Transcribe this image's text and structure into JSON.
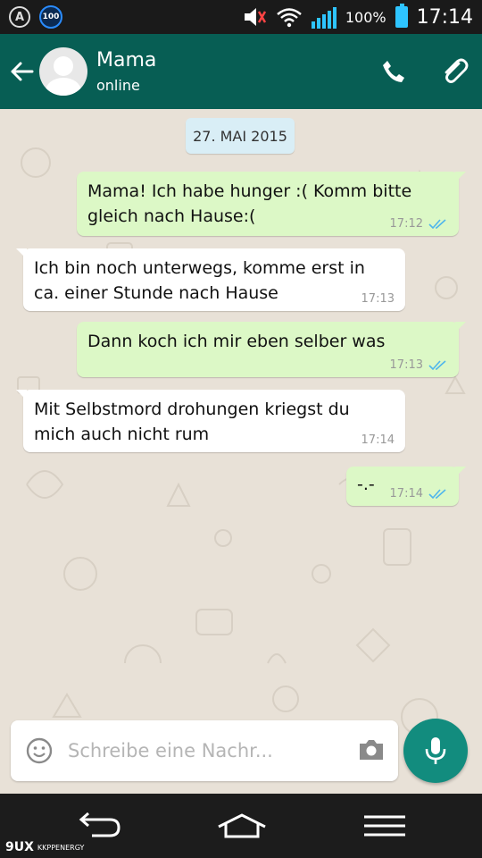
{
  "status_bar": {
    "battery_percent": "100%",
    "time": "17:14",
    "notif_badge": "100",
    "accent_color": "#2ec4ff"
  },
  "header": {
    "contact_name": "Mama",
    "contact_status": "online",
    "color": "#075e54"
  },
  "chat": {
    "date_label": "27. MAI 2015",
    "messages": [
      {
        "direction": "out",
        "text": "Mama! Ich habe hunger :( Komm bitte gleich nach Hause:(",
        "time": "17:12",
        "read": true
      },
      {
        "direction": "in",
        "text": "Ich bin noch unterwegs, komme erst in ca. einer Stunde nach Hause",
        "time": "17:13"
      },
      {
        "direction": "out",
        "text": "Dann koch ich mir eben selber was",
        "time": "17:13",
        "read": true
      },
      {
        "direction": "in",
        "text": "Mit Selbstmord drohungen kriegst du mich auch nicht rum",
        "time": "17:14"
      },
      {
        "direction": "out",
        "text": "-.-",
        "time": "17:14",
        "read": true
      }
    ]
  },
  "composer": {
    "placeholder": "Schreibe eine Nachr..."
  },
  "watermark": {
    "logo": "9UX",
    "sub": "KKPPENERGY"
  }
}
